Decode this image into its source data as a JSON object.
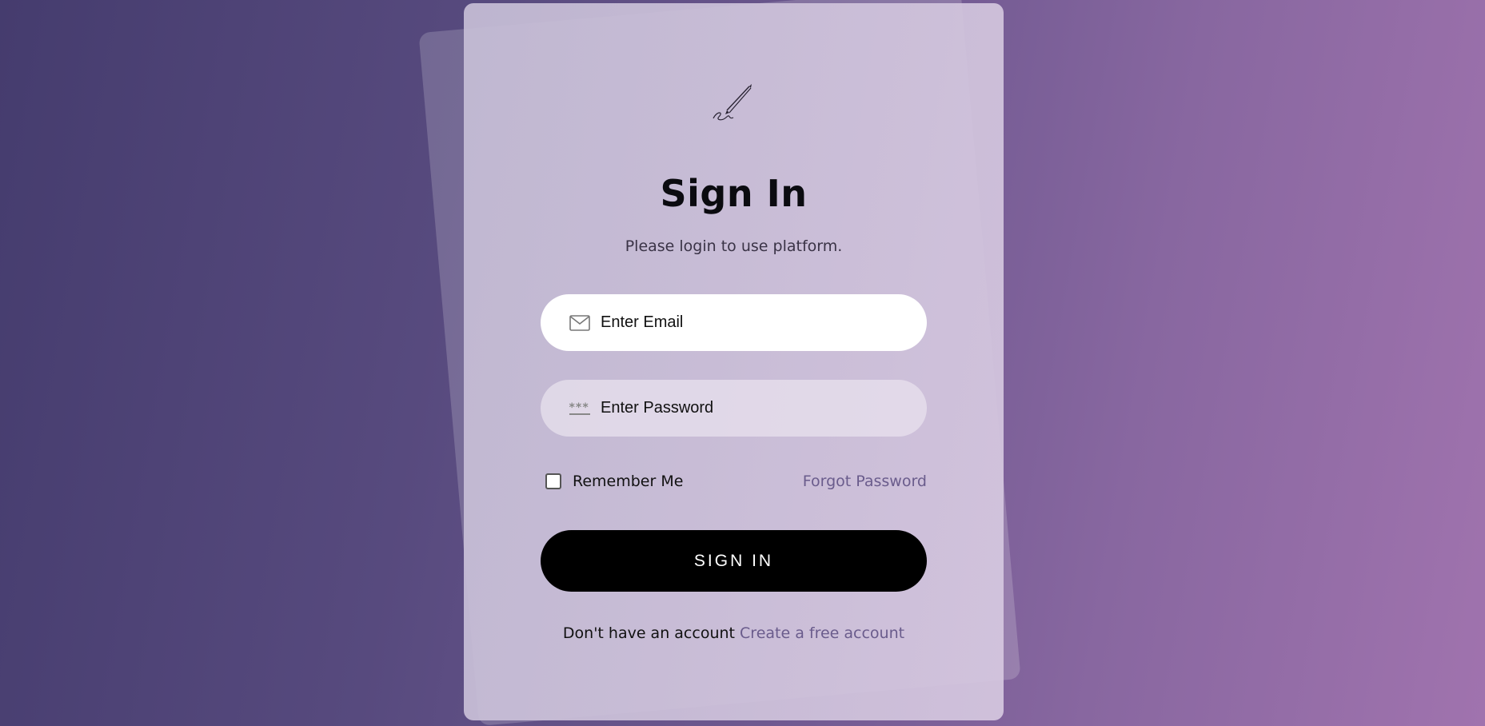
{
  "logo": {
    "icon": "pen-signature-icon"
  },
  "signin": {
    "title": "Sign In",
    "subtitle": "Please login to use platform.",
    "email_placeholder": "Enter Email",
    "email_icon": "envelope-icon",
    "password_placeholder": "Enter Password",
    "password_icon": "password-asterisks-icon",
    "remember_label": "Remember Me",
    "remember_checked": false,
    "forgot_label": "Forgot Password",
    "button_label": "SIGN IN",
    "footer_text": "Don't have an account",
    "footer_link": "Create a free account"
  },
  "colors": {
    "accent_link": "#6a5c8c",
    "button_bg": "#000000",
    "bg_left": "#453c6e",
    "bg_right": "#a073ae"
  }
}
